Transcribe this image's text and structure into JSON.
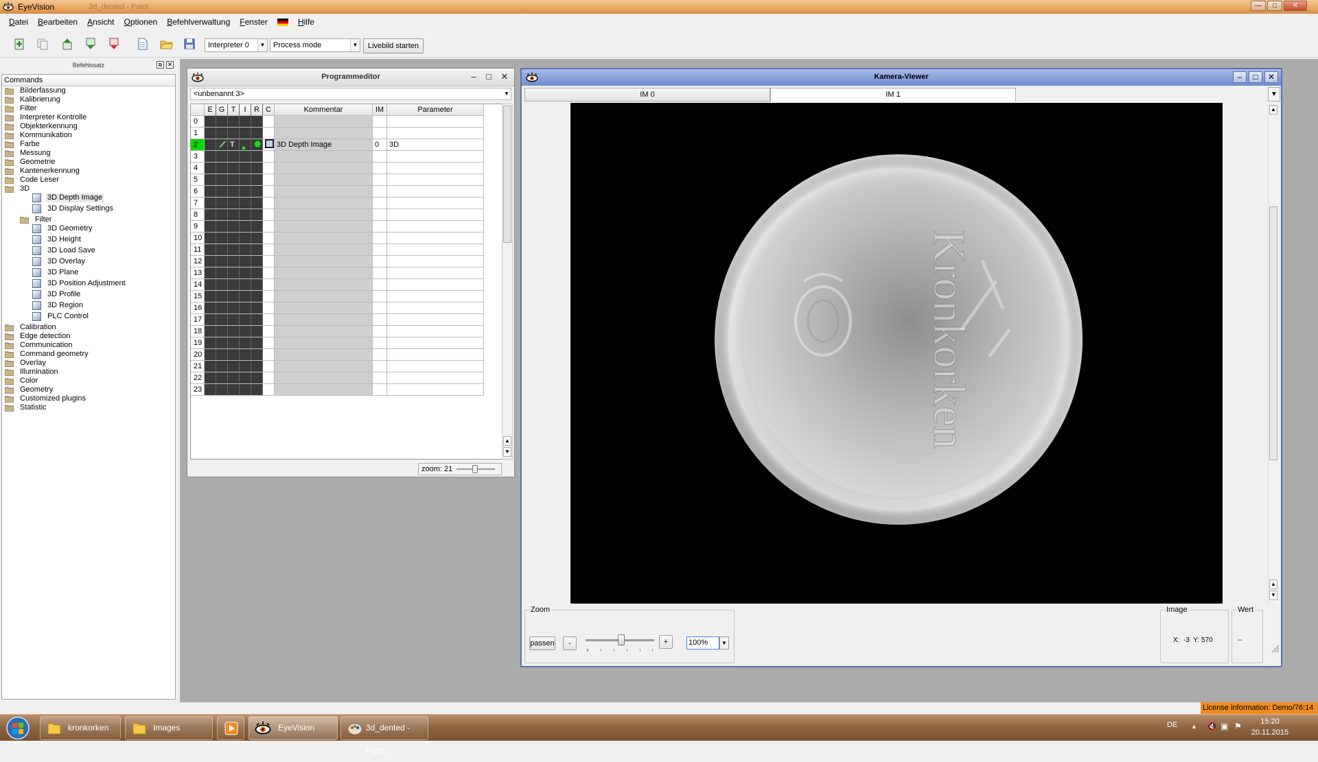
{
  "window": {
    "title": "EyeVision",
    "ghost_title": "3d_dented - Paint",
    "controls": {
      "minimize": "—",
      "maximize": "□",
      "close": "✕"
    }
  },
  "menu": [
    "Datei",
    "Bearbeiten",
    "Ansicht",
    "Optionen",
    "Befehlverwaltung",
    "Fenster",
    "Hilfe"
  ],
  "toolbar": {
    "interpreter": "Interpreter 0",
    "mode": "Process mode",
    "live_button": "Livebild starten"
  },
  "left_panel": {
    "header": "Befehlssatz",
    "column": "Commands",
    "tree": [
      {
        "label": "Bilderfassung",
        "level": 0
      },
      {
        "label": "Kalibrierung",
        "level": 0
      },
      {
        "label": "Filter",
        "level": 0
      },
      {
        "label": "Interpreter Kontrolle",
        "level": 0
      },
      {
        "label": "Objekterkennung",
        "level": 0
      },
      {
        "label": "Kommunikation",
        "level": 0
      },
      {
        "label": "Farbe",
        "level": 0
      },
      {
        "label": "Messung",
        "level": 0
      },
      {
        "label": "Geometrie",
        "level": 0
      },
      {
        "label": "Kantenerkennung",
        "level": 0
      },
      {
        "label": "Code Leser",
        "level": 0
      },
      {
        "label": "3D",
        "level": 0
      },
      {
        "label": "3D Depth Image",
        "level": 2,
        "selected": true
      },
      {
        "label": "3D Display Settings",
        "level": 2
      },
      {
        "label": "Filter",
        "level": 1
      },
      {
        "label": "3D Geometry",
        "level": 2
      },
      {
        "label": "3D Height",
        "level": 2
      },
      {
        "label": "3D Load Save",
        "level": 2
      },
      {
        "label": "3D Overlay",
        "level": 2
      },
      {
        "label": "3D Plane",
        "level": 2
      },
      {
        "label": "3D Position Adjustment",
        "level": 2
      },
      {
        "label": "3D Profile",
        "level": 2
      },
      {
        "label": "3D Region",
        "level": 2
      },
      {
        "label": "PLC Control",
        "level": 2
      },
      {
        "label": "Calibration",
        "level": 0
      },
      {
        "label": "Edge detection",
        "level": 0
      },
      {
        "label": "Communication",
        "level": 0
      },
      {
        "label": "Command geometry",
        "level": 0
      },
      {
        "label": "Overlay",
        "level": 0
      },
      {
        "label": "Illumination",
        "level": 0
      },
      {
        "label": "Color",
        "level": 0
      },
      {
        "label": "Geometry",
        "level": 0
      },
      {
        "label": "Customized plugins",
        "level": 0
      },
      {
        "label": "Statistic",
        "level": 0
      }
    ]
  },
  "program_editor": {
    "title": "Programmeditor",
    "program": "<unbenannt 3>",
    "columns": [
      "",
      "E",
      "G",
      "T",
      "I",
      "R",
      "C",
      "Kommentar",
      "IM",
      "Parameter"
    ],
    "rows": [
      {
        "n": "0"
      },
      {
        "n": "1"
      },
      {
        "n": "2",
        "active": true,
        "comment": "3D Depth Image",
        "im": "0",
        "param": "3D"
      },
      {
        "n": "3"
      },
      {
        "n": "4"
      },
      {
        "n": "5"
      },
      {
        "n": "6"
      },
      {
        "n": "7"
      },
      {
        "n": "8"
      },
      {
        "n": "9"
      },
      {
        "n": "10"
      },
      {
        "n": "11"
      },
      {
        "n": "12"
      },
      {
        "n": "13"
      },
      {
        "n": "14"
      },
      {
        "n": "15"
      },
      {
        "n": "16"
      },
      {
        "n": "17"
      },
      {
        "n": "18"
      },
      {
        "n": "19"
      },
      {
        "n": "20"
      },
      {
        "n": "21"
      },
      {
        "n": "22"
      },
      {
        "n": "23"
      }
    ],
    "zoom_label": "zoom: 21"
  },
  "camera_viewer": {
    "title": "Kamera-Viewer",
    "tabs": [
      "IM 0",
      "IM 1"
    ],
    "active_tab": 1,
    "image_text": "Kronkorken",
    "zoom_group": "Zoom",
    "fit_button": "passen",
    "minus": "-",
    "plus": "+",
    "zoom_value": "100%",
    "image_group": "Image",
    "coords": "X:  -3  Y: 570",
    "value_group": "Wert",
    "value": "--"
  },
  "license": "License information: Demo/76:14",
  "taskbar": {
    "tasks": [
      "kronkorken",
      "Images",
      "",
      "EyeVision",
      "3d_dented - Paint"
    ],
    "lang": "DE",
    "time": "15:20",
    "date": "20.11.2015"
  },
  "colors": {
    "active_row": "#00d800",
    "license_bg": "#ef8c1e",
    "viewer_title": "#6f8ccd"
  }
}
